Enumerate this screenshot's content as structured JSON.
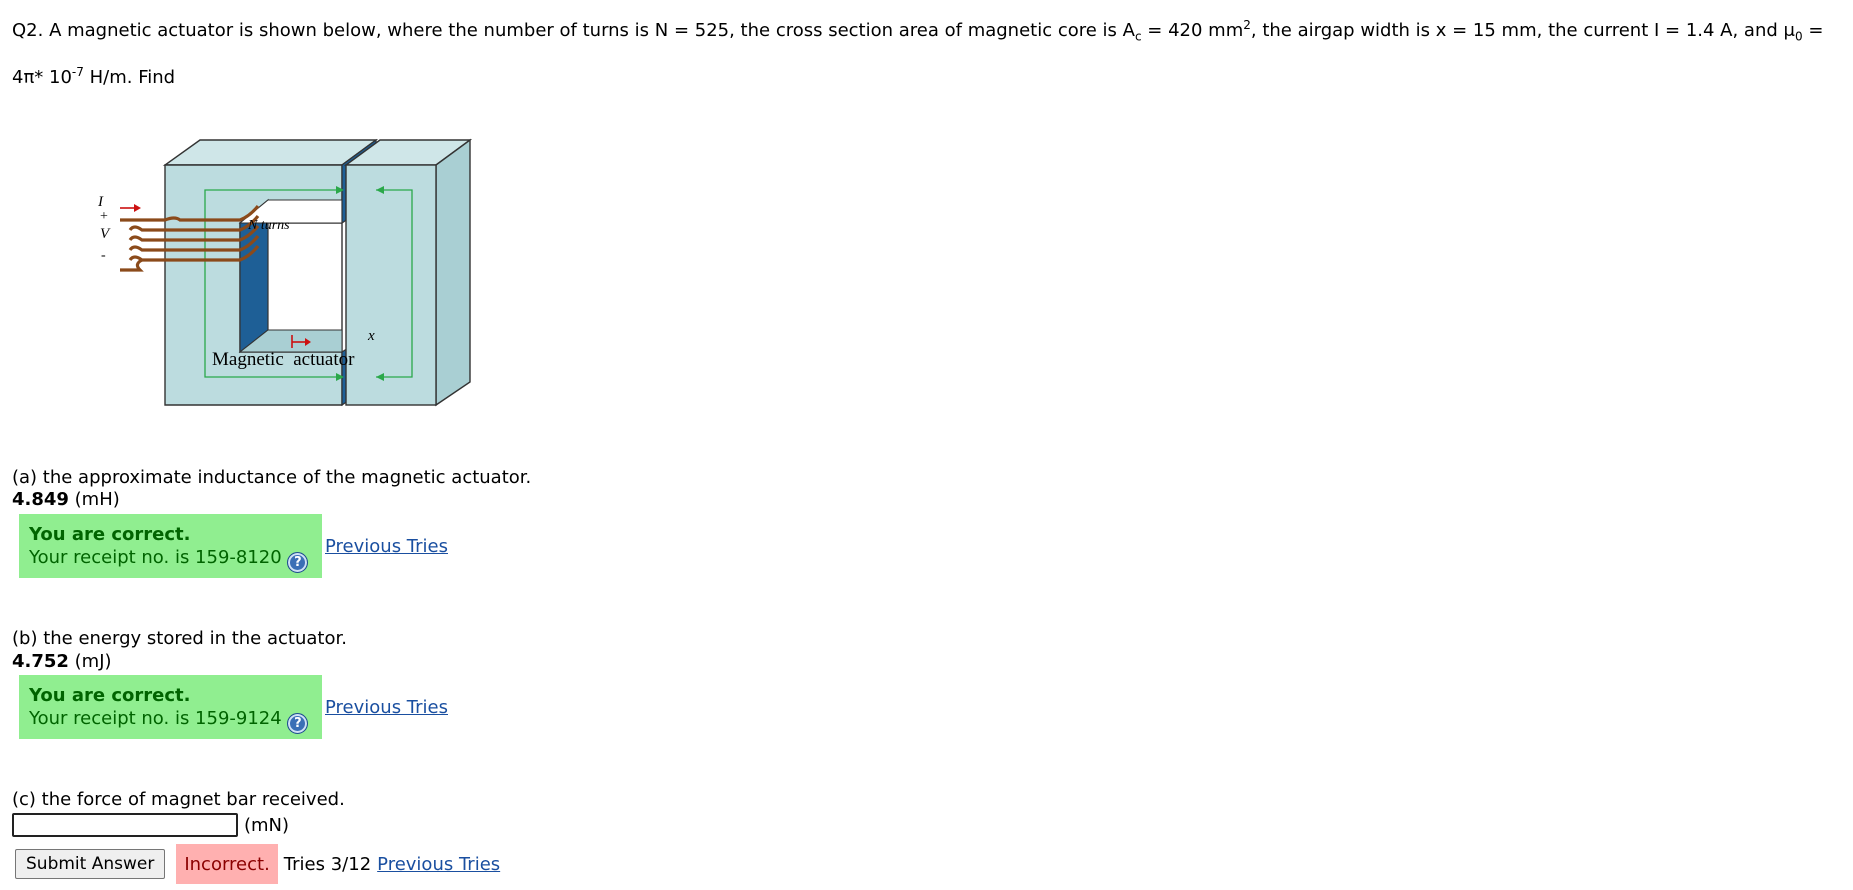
{
  "question": {
    "intro": "Q2. A magnetic actuator is shown below, where the number of turns is N = 525, the cross section area of magnetic core is A",
    "ac_sub": "c",
    "ac_mid": " = 420 mm",
    "ac_sup": "2",
    "mid2": ", the airgap width is x = 15 mm, the current I = 1.4 A, and μ",
    "mu_sub": "0",
    "mu_eq": " =",
    "line2_pre": "4π* 10",
    "exp": "-7",
    "line2_post": " H/m. Find"
  },
  "figure": {
    "coil_label": "N turns",
    "caption": "Magnetic  actuator",
    "label_I": "I",
    "label_plus": "+",
    "label_V": "V",
    "label_minus": "-",
    "label_x": "x"
  },
  "parts": {
    "a": {
      "label": "(a) the approximate inductance of the magnetic actuator.",
      "value": "4.849",
      "unit": " (mH)",
      "status": "You are correct.",
      "receipt": "Your receipt no. is 159-8120",
      "prev": "Previous Tries"
    },
    "b": {
      "label": "(b) the energy stored in the actuator.",
      "value": "4.752",
      "unit": " (mJ)",
      "status": "You are correct.",
      "receipt": "Your receipt no. is 159-9124",
      "prev": "Previous Tries"
    },
    "c": {
      "label": "(c) the force of magnet bar received.",
      "input_value": "",
      "unit": "(mN)",
      "submit": "Submit Answer",
      "status": "Incorrect.",
      "tries": "Tries 3/12",
      "prev": "Previous Tries"
    }
  },
  "help_glyph": "?",
  "colors": {
    "correct_bg": "#90ee90",
    "correct_text": "#006400",
    "incorrect_bg": "#ffb0b0",
    "link": "#1a4fa0",
    "core_face": "#bcdcdf",
    "gap_blue": "#1e5f96",
    "coil": "#8b4a1a",
    "flux_green": "#2aa84a"
  }
}
